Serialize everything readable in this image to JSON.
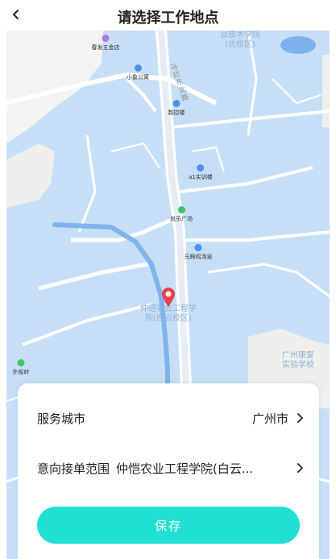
{
  "header": {
    "title": "请选择工作地点"
  },
  "map": {
    "pois": [
      {
        "label": "春发五金店",
        "icon": "shop-icon",
        "color": "#a77be0"
      },
      {
        "label": "小象公寓",
        "icon": "building-icon",
        "color": "#4e8ff0"
      },
      {
        "label": "数控楼",
        "icon": "building-icon",
        "color": "#4e8ff0"
      },
      {
        "label": "a1实训楼",
        "icon": "building-icon",
        "color": "#4e8ff0"
      },
      {
        "label": "尚乐广场",
        "icon": "park-icon",
        "color": "#43c26b"
      },
      {
        "label": "马蹄鸡汤泉",
        "icon": "building-icon",
        "color": "#4e8ff0"
      },
      {
        "label": "扑船岭",
        "icon": "mountain-icon",
        "color": "#43c26b"
      }
    ],
    "areas": {
      "college_top": "业技术学院\n(北校区)",
      "college_main": "仲恺农业工程学\n院(白云校区)",
      "college_right": "广州康复\n实验学校"
    },
    "road_label": "马拦东北路",
    "marker_color": "#e8404a"
  },
  "form": {
    "service_city_label": "服务城市",
    "service_city_value": "广州市",
    "range_label": "意向接单范围",
    "range_value": "仲恺农业工程学院(白云..."
  },
  "save_button": {
    "label": "保存",
    "color": "#21e0d3"
  }
}
